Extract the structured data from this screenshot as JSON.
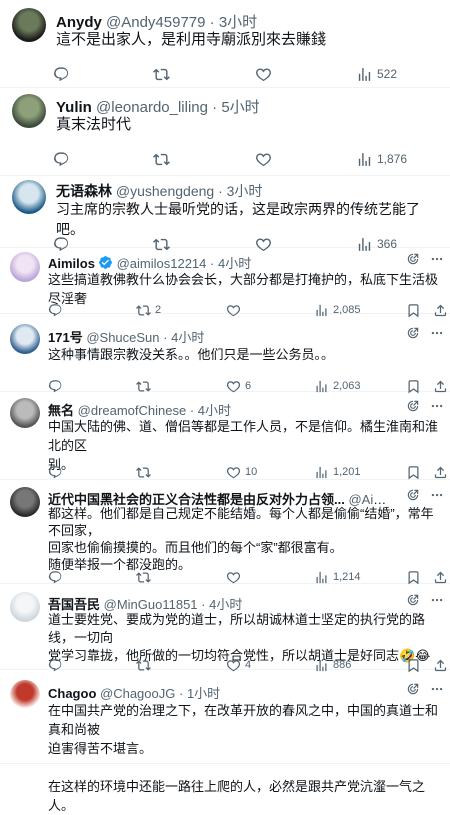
{
  "tweets": [
    {
      "name": "Anydy",
      "handle": "@Andy459779",
      "sep": " · ",
      "time": "3小时",
      "text": [
        "這不是出家人，是利用寺廟派別來去賺錢"
      ],
      "reply_count": "",
      "retweet_count": "",
      "like_count": "",
      "views": "522",
      "avatar_colors": [
        "#1a1a1a",
        "#6b7a5a"
      ]
    },
    {
      "name": "Yulin",
      "handle": "@leonardo_liling",
      "sep": " · ",
      "time": "5小时",
      "text": [
        "真末法时代"
      ],
      "reply_count": "",
      "retweet_count": "",
      "like_count": "",
      "views": "1,876",
      "avatar_colors": [
        "#3c4a3a",
        "#8ea07a"
      ]
    },
    {
      "name": "无语森林",
      "handle": "@yushengdeng",
      "sep": " · ",
      "time": "3小时",
      "text": [
        "习主席的宗教人士最听党的话，这是政宗两界的传统艺能了吧。"
      ],
      "reply_count": "",
      "retweet_count": "",
      "like_count": "",
      "views": "366",
      "avatar_colors": [
        "#1d5c8a",
        "#d7e6ee"
      ]
    },
    {
      "name": "Aimilos",
      "handle": "@aimilos12214",
      "sep": " · ",
      "time": "4小时",
      "verified": true,
      "text": [
        "这些搞道教佛教什么协会会长，大部分都是打掩护的，私底下生活极尽淫奢"
      ],
      "reply_count": "",
      "retweet_count": "2",
      "like_count": "",
      "views": "2,085",
      "avatar_colors": [
        "#b9a6d9",
        "#f0e4f5"
      ]
    },
    {
      "name": "171号",
      "handle": "@ShuceSun",
      "sep": " · ",
      "time": "4小时",
      "text": [
        "这种事情跟宗教没关系。。他们只是一些公务员。。"
      ],
      "reply_count": "",
      "retweet_count": "",
      "like_count": "6",
      "views": "2,063",
      "avatar_colors": [
        "#2f5f8f",
        "#dfe9f2"
      ]
    },
    {
      "name": "無名",
      "handle": "@dreamofChinese",
      "sep": " · ",
      "time": "4小时",
      "text": [
        "中国大陆的佛、道、僧侣等都是工作人员，不是信仰。橘生淮南和淮北的区",
        "别。"
      ],
      "reply_count": "",
      "retweet_count": "",
      "like_count": "10",
      "views": "1,201",
      "avatar_colors": [
        "#555555",
        "#bbbbbb"
      ]
    },
    {
      "name": "近代中国黑社会的正义合法性都是由反对外力占领...",
      "handle": "@Aiyu...",
      "sep": " · ",
      "time": "3小时",
      "text": [
        "都这样。他们都是自己规定不能结婚。每个人都是偷偷“结婚”，常年不回家，",
        "回家也偷偷摸摸的。而且他们的每个“家”都很富有。",
        "随便举报一个都没跑的。"
      ],
      "reply_count": "",
      "retweet_count": "",
      "like_count": "",
      "views": "1,214",
      "avatar_colors": [
        "#2a2a2a",
        "#777777"
      ]
    },
    {
      "name": "吾国吾民",
      "handle": "@MinGuo11851",
      "sep": " · ",
      "time": "4小时",
      "text": [
        "道士要姓党、要成为党的道士，所以胡诚林道士坚定的执行党的路线，一切向",
        "党学习靠拢，他所做的一切均符合党性，所以胡道士是好同志🤣😂"
      ],
      "reply_count": "",
      "retweet_count": "",
      "like_count": "4",
      "views": "886",
      "avatar_colors": [
        "#cfd6dc",
        "#f4f6f7"
      ]
    },
    {
      "name": "Chagoo",
      "handle": "@ChagooJG",
      "sep": " · ",
      "time": "1小时",
      "text": [
        "在中国共产党的治理之下，在改革开放的春风之中，中国的真道士和真和尚被",
        "迫害得苦不堪言。",
        "",
        "在这样的环境中还能一路往上爬的人，必然是跟共产党沆瀣一气之人。"
      ],
      "reply_count": "",
      "retweet_count": "",
      "like_count": "",
      "views": "",
      "avatar_colors": [
        "#ffffff",
        "#c0392b"
      ]
    }
  ]
}
